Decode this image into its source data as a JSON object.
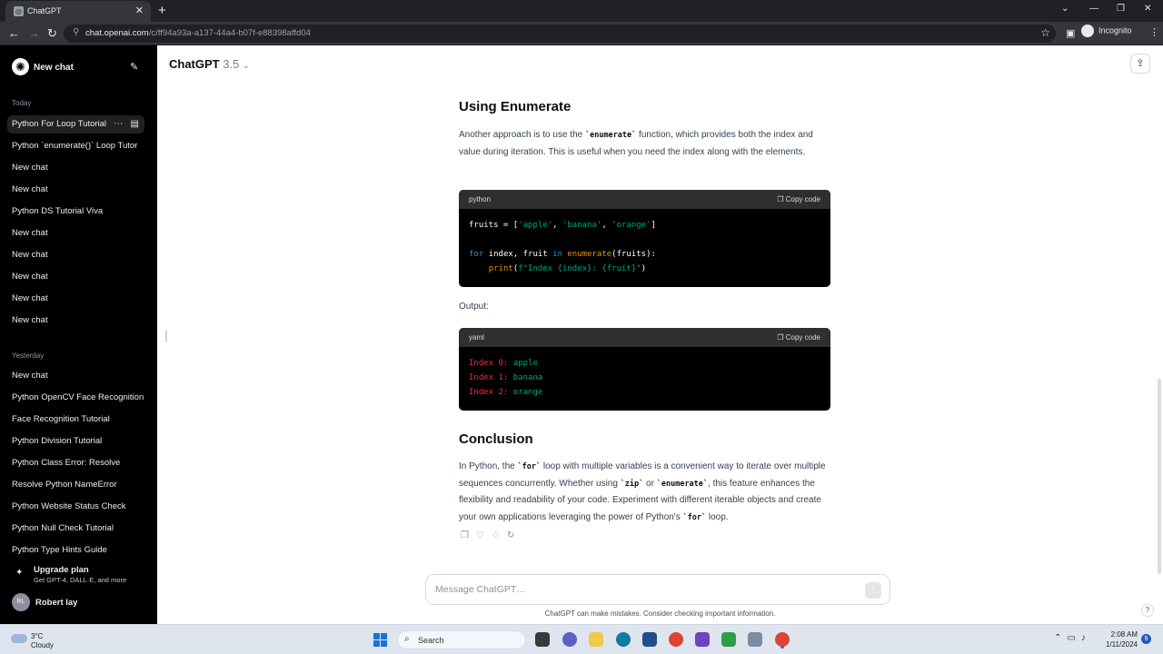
{
  "browser": {
    "tab_title": "ChatGPT",
    "url_host": "chat.openai.com",
    "url_path": "/c/ff94a93a-a137-44a4-b07f-e88398affd04",
    "profile": "Incognito"
  },
  "sidebar": {
    "new_chat": "New chat",
    "today_label": "Today",
    "today": [
      "Python For Loop Tutorial",
      "Python `enumerate()` Loop Tutor",
      "New chat",
      "New chat",
      "Python DS Tutorial Viva",
      "New chat",
      "New chat",
      "New chat",
      "New chat",
      "New chat"
    ],
    "yesterday_label": "Yesterday",
    "yesterday": [
      "New chat",
      "Python OpenCV Face Recognition",
      "Face Recognition Tutorial",
      "Python Division Tutorial",
      "Python Class Error: Resolve",
      "Resolve Python NameError",
      "Python Website Status Check",
      "Python Null Check Tutorial",
      "Python Type Hints Guide"
    ],
    "upgrade_title": "Upgrade plan",
    "upgrade_sub": "Get GPT-4, DALL·E, and more",
    "user_initials": "RL",
    "user_name": "Robert lay"
  },
  "header": {
    "model": "ChatGPT",
    "version": "3.5"
  },
  "content": {
    "h_enumerate": "Using Enumerate",
    "p_enum_a": "Another approach is to use the ",
    "p_enum_code": "`enumerate`",
    "p_enum_b": " function, which provides both the index and value during iteration. This is useful when you need the index along with the elements.",
    "code1_lang": "python",
    "copy_label": "Copy code",
    "output_label": "Output:",
    "code2_lang": "yaml",
    "h_conclusion": "Conclusion",
    "c_a": "In Python, the ",
    "c_for": "`for`",
    "c_b": " loop with multiple variables is a convenient way to iterate over multiple sequences concurrently. Whether using ",
    "c_zip": "`zip`",
    "c_or": " or ",
    "c_enum": "`enumerate`",
    "c_c": ", this feature enhances the flexibility and readability of your code. Experiment with different iterable objects and create your own applications leveraging the power of Python's ",
    "c_for2": "`for`",
    "c_d": " loop."
  },
  "code1": {
    "l1_a": "fruits = [",
    "l1_s1": "'apple'",
    "l1_c1": ", ",
    "l1_s2": "'banana'",
    "l1_c2": ", ",
    "l1_s3": "'orange'",
    "l1_end": "]",
    "l2_for": "for",
    "l2_a": " index, fruit ",
    "l2_in": "in",
    "l2_sp": " ",
    "l2_fn": "enumerate",
    "l2_b": "(fruits):",
    "l3_ind": "    ",
    "l3_fn": "print",
    "l3_a": "(",
    "l3_str": "f\"Index {index}: {fruit}\"",
    "l3_b": ")"
  },
  "code2": {
    "k0": "Index 0:",
    "v0": " apple",
    "k1": "Index 1:",
    "v1": " banana",
    "k2": "Index 2:",
    "v2": " orange"
  },
  "composer": {
    "placeholder": "Message ChatGPT…",
    "disclaimer": "ChatGPT can make mistakes. Consider checking important information."
  },
  "taskbar": {
    "temp": "3°C",
    "condition": "Cloudy",
    "search": "Search",
    "time": "2:08 AM",
    "date": "1/11/2024",
    "notifications": "9"
  },
  "colors": {
    "sidebar_bg": "#000000",
    "code_header": "#2f2f2f",
    "keyword": "#2e95d3",
    "string": "#00a67d",
    "yaml_key": "#f22c3d"
  }
}
